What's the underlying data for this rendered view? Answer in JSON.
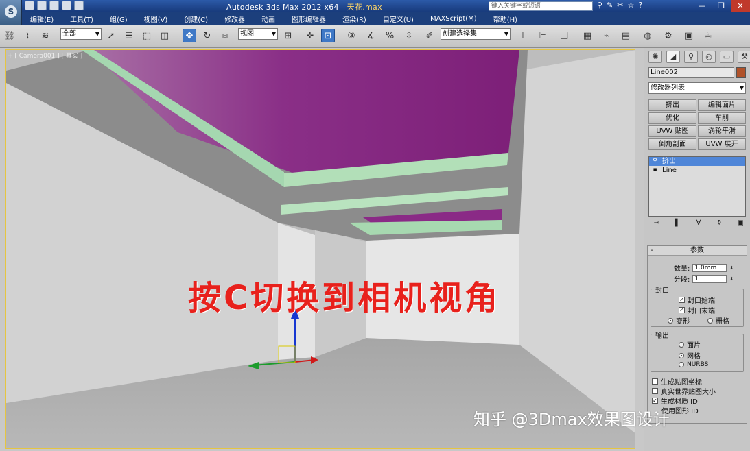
{
  "titlebar": {
    "title": "Autodesk 3ds Max  2012 x64",
    "file": "天花.max",
    "search_placeholder": "键入关键字或短语",
    "help_icon": "?"
  },
  "menu": [
    "编辑(E)",
    "工具(T)",
    "组(G)",
    "视图(V)",
    "创建(C)",
    "修改器",
    "动画",
    "图形编辑器",
    "渲染(R)",
    "自定义(U)",
    "MAXScript(M)",
    "帮助(H)"
  ],
  "toolbar": {
    "selection_filter": "全部",
    "reference_coord": "视图",
    "named_selection": "创建选择集"
  },
  "viewport": {
    "label": "+ [ Camera001 ] [ 真实 ]",
    "caption": "按C切换到相机视角"
  },
  "command_panel": {
    "object_name": "Line002",
    "object_color": "#b0522a",
    "modifier_list": "修改器列表",
    "modifier_buttons": [
      "挤出",
      "编辑面片",
      "优化",
      "车削",
      "UVW 贴图",
      "涡轮平滑",
      "倒角剖面",
      "UVW 展开"
    ],
    "stack": [
      {
        "label": "挤出",
        "selected": true
      },
      {
        "label": "Line",
        "selected": false
      }
    ],
    "params": {
      "title": "参数",
      "amount_label": "数量:",
      "amount_value": "1.0mm",
      "segments_label": "分段:",
      "segments_value": "1",
      "capping_title": "封口",
      "cap_start": "封口始端",
      "cap_end": "封口末端",
      "morph": "变形",
      "grid": "栅格",
      "output_title": "输出",
      "out_patch": "面片",
      "out_mesh": "网格",
      "out_nurbs": "NURBS",
      "gen_map_coords": "生成贴图坐标",
      "real_world_map": "真实世界贴图大小",
      "gen_material_ids": "生成材质 ID",
      "use_shape_ids": "使用图形 ID"
    }
  },
  "watermark": "知乎 @3Dmax效果图设计"
}
